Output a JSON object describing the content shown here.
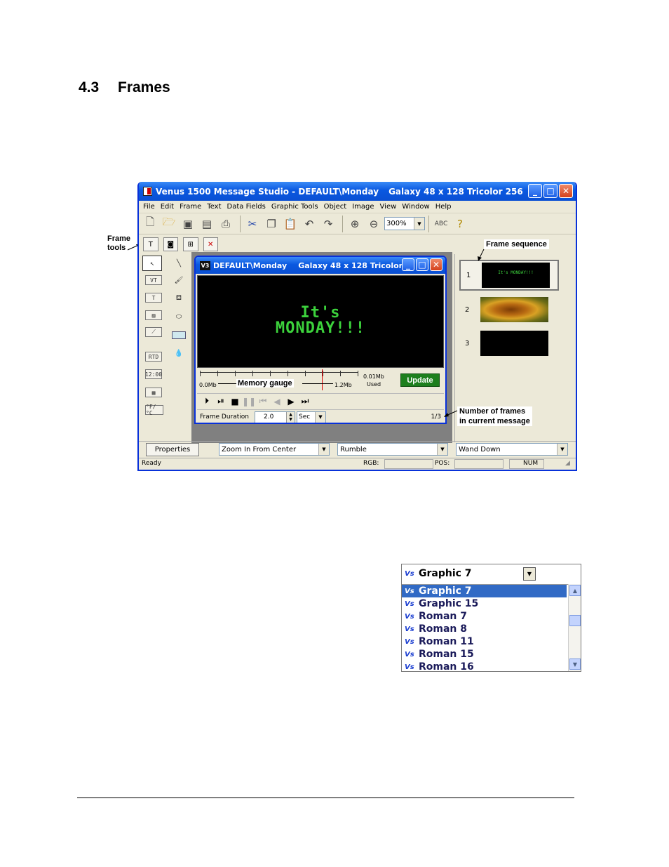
{
  "section": {
    "number": "4.3",
    "title": "Frames"
  },
  "app": {
    "title": "Venus 1500 Message Studio - DEFAULT\\Monday",
    "title_sub": "Galaxy 48 x 128 Tricolor 256",
    "menu": [
      "File",
      "Edit",
      "Frame",
      "Text",
      "Data Fields",
      "Graphic Tools",
      "Object",
      "Image",
      "View",
      "Window",
      "Help"
    ],
    "zoom": "300%",
    "tools": {
      "rtd": "RTD",
      "time": "12:00",
      "temp": "°F/°C"
    },
    "child": {
      "title": "DEFAULT\\Monday",
      "title_sub": "Galaxy 48 x 128 Tricolor...",
      "icon": "V3",
      "display_line1": "It's",
      "display_line2": "MONDAY!!!",
      "gauge_min": "0.0Mb",
      "gauge_max": "1.2Mb",
      "used_value": "0.01Mb",
      "used_label": "Used",
      "update": "Update",
      "frame_duration_label": "Frame Duration",
      "frame_duration": "2.0",
      "duration_unit": "Sec",
      "frame_count": "1/3"
    },
    "sequence": [
      {
        "num": "1",
        "thumb_text": "It's MONDAY!!!"
      },
      {
        "num": "2"
      },
      {
        "num": "3"
      }
    ],
    "properties": "Properties",
    "effects": [
      "Zoom In From Center",
      "Rumble",
      "Wand Down"
    ],
    "status": {
      "ready": "Ready",
      "rgb": "RGB:",
      "pos": "POS:",
      "num": "NUM"
    }
  },
  "annotations": {
    "frame_tools": "Frame\ntools",
    "frame_tools_l1": "Frame",
    "frame_tools_l2": "tools",
    "frame_sequence": "Frame sequence",
    "memory_gauge": "Memory gauge",
    "num_frames_l1": "Number of frames",
    "num_frames_l2": "in current message"
  },
  "font_dropdown": {
    "selected": "Graphic 7",
    "icon": "Vs",
    "options": [
      "Graphic 7",
      "Graphic 15",
      "Roman 7",
      "Roman 8",
      "Roman 11",
      "Roman 15",
      "Roman 16"
    ]
  }
}
